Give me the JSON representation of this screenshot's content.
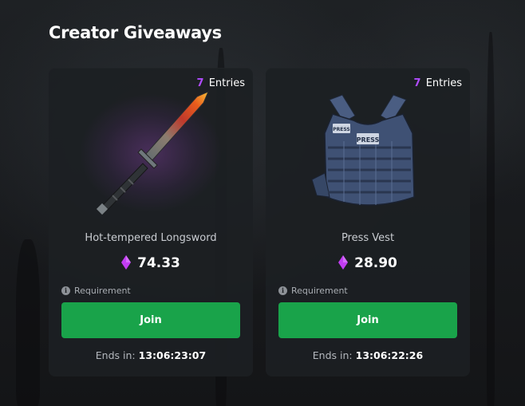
{
  "page": {
    "title": "Creator Giveaways"
  },
  "giveaways": [
    {
      "entries_count": "7",
      "entries_label": "Entries",
      "item_name": "Hot-tempered Longsword",
      "price": "74.33",
      "requirement_label": "Requirement",
      "join_label": "Join",
      "ends_label": "Ends in:",
      "ends_time": "13:06:23:07"
    },
    {
      "entries_count": "7",
      "entries_label": "Entries",
      "item_name": "Press Vest",
      "price": "28.90",
      "requirement_label": "Requirement",
      "join_label": "Join",
      "ends_label": "Ends in:",
      "ends_time": "13:06:22:26"
    }
  ],
  "colors": {
    "accent_purple": "#b04cff",
    "gem": "#c23cf2",
    "join_green": "#19a34a",
    "card_bg": "#1c1f23"
  },
  "icons": {
    "currency": "gem-icon",
    "info": "info-icon"
  }
}
